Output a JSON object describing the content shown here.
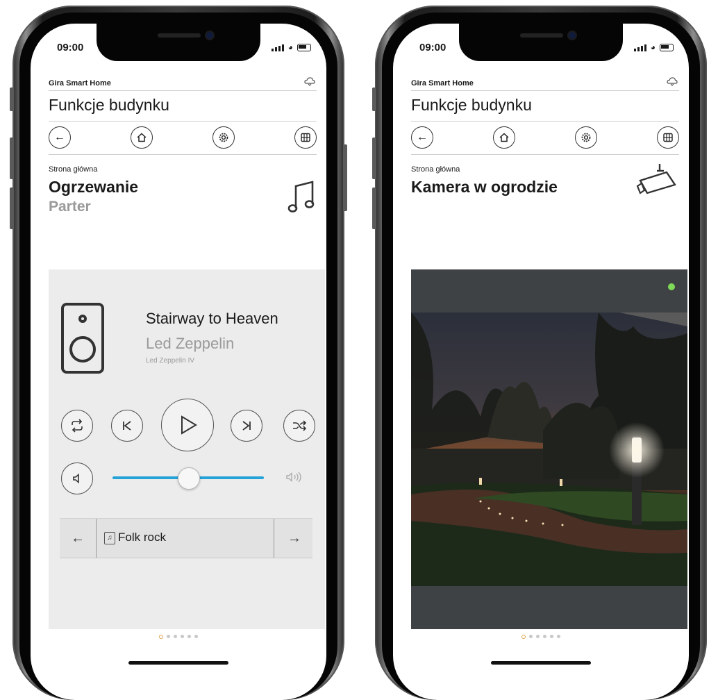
{
  "left": {
    "time": "09:00",
    "app_brand": "Gira Smart Home",
    "page_title": "Funkcje budynku",
    "nav": {
      "back_icon": "arrow-left-icon",
      "home_icon": "home-icon",
      "settings_icon": "gear-icon",
      "grid_icon": "grid-icon"
    },
    "breadcrumb": "Strona główna",
    "room_title": "Ogrzewanie",
    "room_subtitle": "Parter",
    "corner_icon": "music-note-icon",
    "player": {
      "track": "Stairway to Heaven",
      "artist": "Led Zeppelin",
      "album": "Led Zeppelin IV",
      "volume_level": 0.5,
      "genre": "Folk rock"
    },
    "page_index": 1,
    "page_count": 6
  },
  "right": {
    "time": "09:00",
    "app_brand": "Gira Smart Home",
    "page_title": "Funkcje budynku",
    "breadcrumb": "Strona główna",
    "room_title": "Kamera w ogrodzie",
    "corner_icon": "security-camera-icon",
    "camera_status_color": "#7ed957",
    "page_index": 1,
    "page_count": 6
  },
  "colors": {
    "accent": "#25a3d8",
    "muted_text": "#9a9a9a",
    "panel_bg": "#ececec",
    "camera_frame": "#3e4245"
  }
}
